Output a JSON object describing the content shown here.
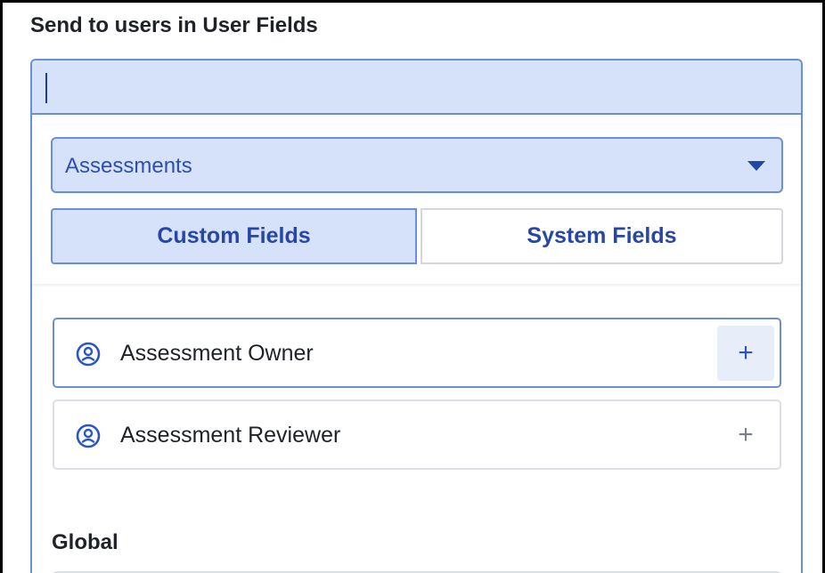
{
  "section": {
    "title": "Send to users in User Fields"
  },
  "search": {
    "value": "",
    "placeholder": ""
  },
  "dropdown": {
    "selected": "Assessments"
  },
  "tabs": [
    {
      "label": "Custom Fields",
      "active": true
    },
    {
      "label": "System Fields",
      "active": false
    }
  ],
  "fields": [
    {
      "label": "Assessment Owner",
      "icon": "user-circle-icon",
      "action_icon": "plus-icon"
    },
    {
      "label": "Assessment Reviewer",
      "icon": "user-circle-icon",
      "action_icon": "plus-icon"
    }
  ],
  "group": {
    "title": "Global"
  },
  "colors": {
    "accent": "#2746a6",
    "accent_light": "#d6e2fa",
    "border_accent": "#6b8fd6",
    "text": "#1f2329"
  }
}
